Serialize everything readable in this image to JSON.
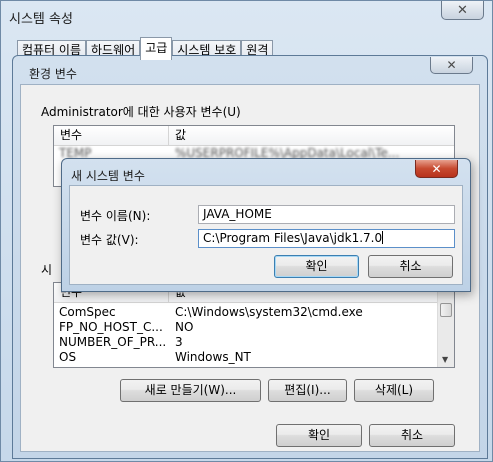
{
  "system_properties": {
    "title": "시스템 속성",
    "tabs": [
      "컴퓨터 이름",
      "하드웨어",
      "고급",
      "시스템 보호",
      "원격"
    ],
    "active_tab_index": 2
  },
  "env_window": {
    "title": "환경 변수",
    "user_section_label": "Administrator에 대한 사용자 변수(U)",
    "columns": {
      "name": "변수",
      "value": "값"
    },
    "user_rows": [
      {
        "name": "TEMP",
        "value": "%USERPROFILE%\\AppData\\Local\\Te..."
      }
    ],
    "system_section_label": "시",
    "system_rows": [
      {
        "name": "ComSpec",
        "value": "C:\\Windows\\system32\\cmd.exe"
      },
      {
        "name": "FP_NO_HOST_C...",
        "value": "NO"
      },
      {
        "name": "NUMBER_OF_PR...",
        "value": "3"
      },
      {
        "name": "OS",
        "value": "Windows_NT"
      }
    ],
    "buttons": {
      "new": "새로 만들기(W)...",
      "edit": "편집(I)...",
      "delete": "삭제(L)",
      "ok": "확인",
      "cancel": "취소"
    }
  },
  "new_var_dialog": {
    "title": "새 시스템 변수",
    "name_label": "변수 이름(N):",
    "name_value": "JAVA_HOME",
    "value_label": "변수 값(V):",
    "value_value": "C:\\Program Files\\Java\\jdk1.7.0",
    "ok_label": "확인",
    "cancel_label": "취소"
  },
  "icons": {
    "close": "close-icon",
    "scroll_down": "chevron-down-icon"
  }
}
